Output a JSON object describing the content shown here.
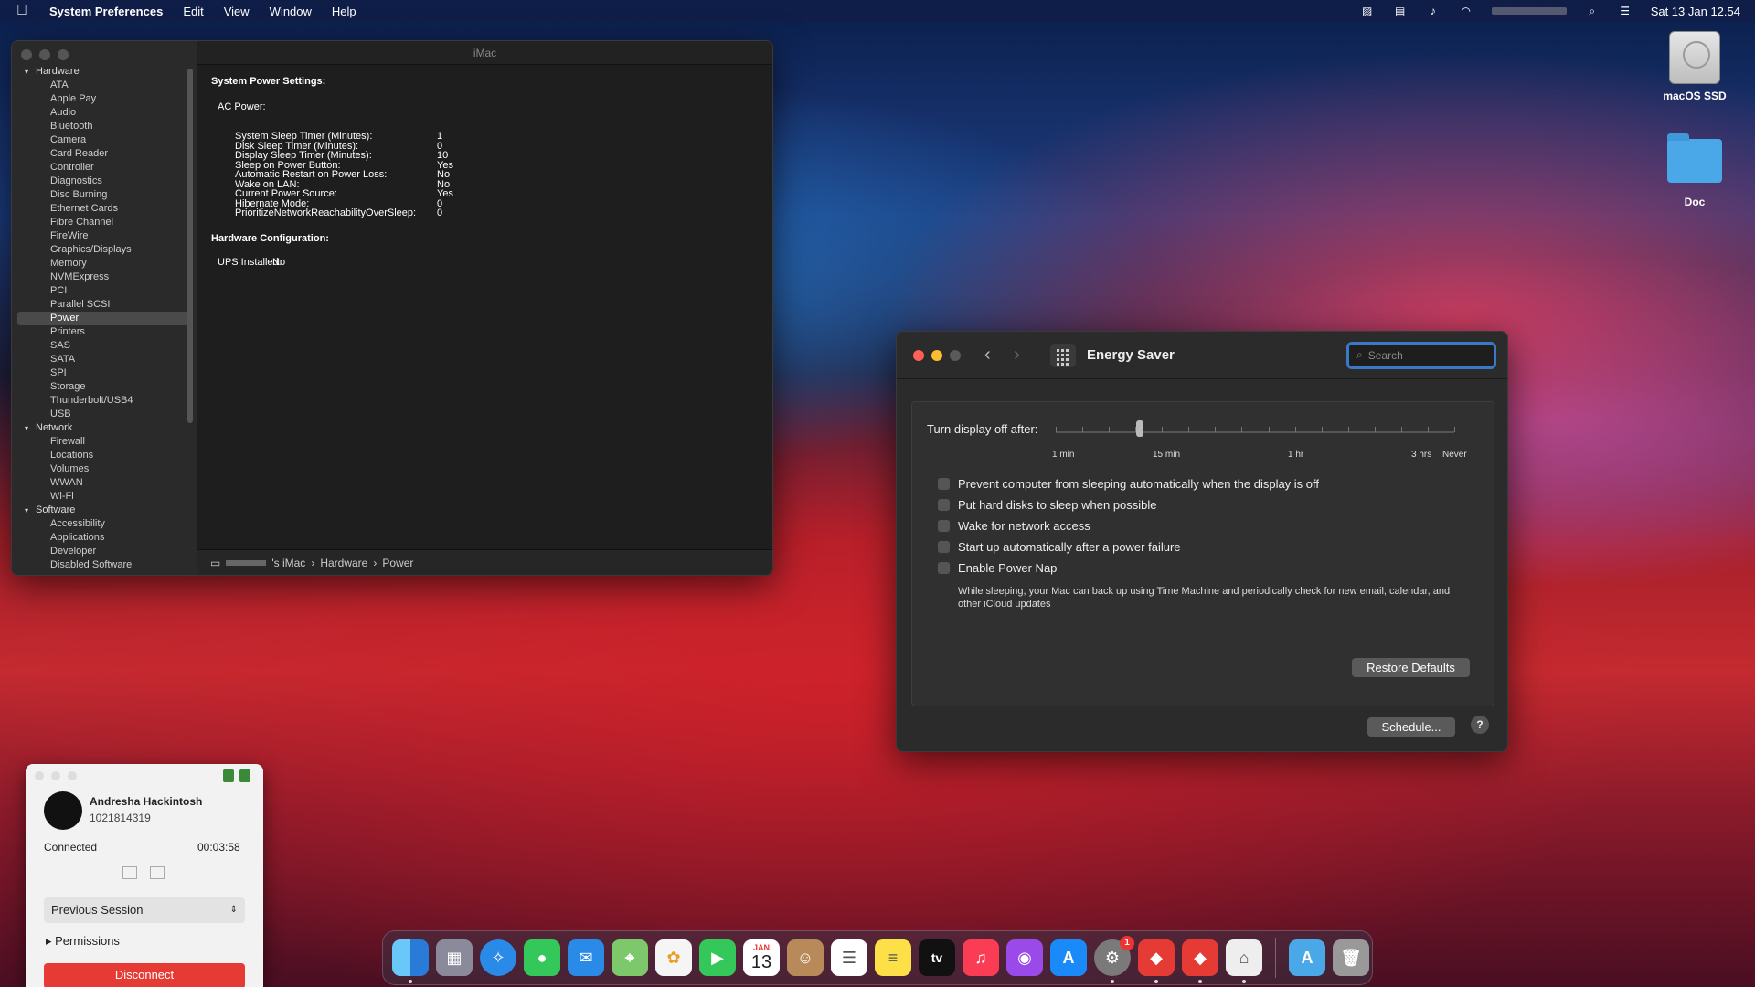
{
  "menubar": {
    "app": "System Preferences",
    "items": [
      "Edit",
      "View",
      "Window",
      "Help"
    ],
    "datetime": "Sat 13 Jan  12.54"
  },
  "desktop": {
    "icons": [
      {
        "label": "macOS SSD"
      },
      {
        "label": "Doc"
      }
    ]
  },
  "sysinfo": {
    "title": "iMac",
    "sidebar": [
      {
        "type": "grp",
        "label": "Hardware"
      },
      {
        "type": "it",
        "label": "ATA"
      },
      {
        "type": "it",
        "label": "Apple Pay"
      },
      {
        "type": "it",
        "label": "Audio"
      },
      {
        "type": "it",
        "label": "Bluetooth"
      },
      {
        "type": "it",
        "label": "Camera"
      },
      {
        "type": "it",
        "label": "Card Reader"
      },
      {
        "type": "it",
        "label": "Controller"
      },
      {
        "type": "it",
        "label": "Diagnostics"
      },
      {
        "type": "it",
        "label": "Disc Burning"
      },
      {
        "type": "it",
        "label": "Ethernet Cards"
      },
      {
        "type": "it",
        "label": "Fibre Channel"
      },
      {
        "type": "it",
        "label": "FireWire"
      },
      {
        "type": "it",
        "label": "Graphics/Displays"
      },
      {
        "type": "it",
        "label": "Memory"
      },
      {
        "type": "it",
        "label": "NVMExpress"
      },
      {
        "type": "it",
        "label": "PCI"
      },
      {
        "type": "it",
        "label": "Parallel SCSI"
      },
      {
        "type": "it",
        "label": "Power",
        "selected": true
      },
      {
        "type": "it",
        "label": "Printers"
      },
      {
        "type": "it",
        "label": "SAS"
      },
      {
        "type": "it",
        "label": "SATA"
      },
      {
        "type": "it",
        "label": "SPI"
      },
      {
        "type": "it",
        "label": "Storage"
      },
      {
        "type": "it",
        "label": "Thunderbolt/USB4"
      },
      {
        "type": "it",
        "label": "USB"
      },
      {
        "type": "grp",
        "label": "Network"
      },
      {
        "type": "it",
        "label": "Firewall"
      },
      {
        "type": "it",
        "label": "Locations"
      },
      {
        "type": "it",
        "label": "Volumes"
      },
      {
        "type": "it",
        "label": "WWAN"
      },
      {
        "type": "it",
        "label": "Wi-Fi"
      },
      {
        "type": "grp",
        "label": "Software"
      },
      {
        "type": "it",
        "label": "Accessibility"
      },
      {
        "type": "it",
        "label": "Applications"
      },
      {
        "type": "it",
        "label": "Developer"
      },
      {
        "type": "it",
        "label": "Disabled Software"
      }
    ],
    "heading1": "System Power Settings:",
    "ac_label": "AC Power:",
    "settings": [
      {
        "k": "System Sleep Timer (Minutes):",
        "v": "1"
      },
      {
        "k": "Disk Sleep Timer (Minutes):",
        "v": "0"
      },
      {
        "k": "Display Sleep Timer (Minutes):",
        "v": "10"
      },
      {
        "k": "Sleep on Power Button:",
        "v": "Yes"
      },
      {
        "k": "Automatic Restart on Power Loss:",
        "v": "No"
      },
      {
        "k": "Wake on LAN:",
        "v": "No"
      },
      {
        "k": "Current Power Source:",
        "v": "Yes"
      },
      {
        "k": "Hibernate Mode:",
        "v": "0"
      },
      {
        "k": "PrioritizeNetworkReachabilityOverSleep:",
        "v": "0"
      }
    ],
    "heading2": "Hardware Configuration:",
    "ups_label": "UPS Installed:",
    "ups_value": "No",
    "path": [
      "'s iMac",
      "›",
      "Hardware",
      "›",
      "Power"
    ]
  },
  "energy": {
    "title": "Energy Saver",
    "search_placeholder": "Search",
    "slider_label": "Turn display off after:",
    "slider_position": 0.21,
    "tick_labels": [
      "1 min",
      "15 min",
      "1 hr",
      "3 hrs",
      "Never"
    ],
    "options": [
      "Prevent computer from sleeping automatically when the display is off",
      "Put hard disks to sleep when possible",
      "Wake for network access",
      "Start up automatically after a power failure",
      "Enable Power Nap"
    ],
    "note": "While sleeping, your Mac can back up using Time Machine and periodically check for new email, calendar, and other iCloud updates",
    "restore": "Restore Defaults",
    "schedule": "Schedule...",
    "help": "?"
  },
  "anydesk": {
    "name": "Andresha Hackintosh",
    "id": "1021814319",
    "status": "Connected",
    "time": "00:03:58",
    "session": "Previous Session",
    "permissions": "Permissions",
    "disconnect": "Disconnect"
  },
  "dock": {
    "calendar_month": "JAN",
    "calendar_day": "13",
    "badge": "1",
    "tv_label": "tv"
  }
}
